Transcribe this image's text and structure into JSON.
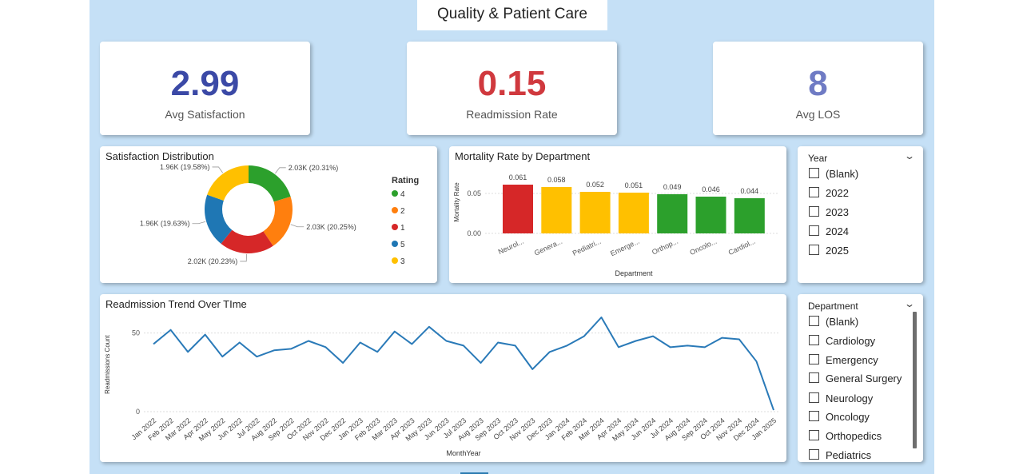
{
  "page_title": "Quality & Patient Care",
  "kpis": [
    {
      "value": "2.99",
      "label": "Avg Satisfaction",
      "color": "#3b49a6"
    },
    {
      "value": "0.15",
      "label": "Readmission Rate",
      "color": "#d0393e"
    },
    {
      "value": "8",
      "label": "Avg LOS",
      "color": "#6f7bc4"
    }
  ],
  "donut": {
    "title": "Satisfaction Distribution",
    "legend_title": "Rating",
    "chart_data": {
      "type": "pie",
      "slices": [
        {
          "rating": "4",
          "value": 2030,
          "label": "2.03K (20.31%)",
          "pct": 20.31,
          "color": "#2ca02c"
        },
        {
          "rating": "2",
          "value": 2030,
          "label": "2.03K (20.25%)",
          "pct": 20.25,
          "color": "#ff7f0e"
        },
        {
          "rating": "1",
          "value": 2020,
          "label": "2.02K (20.23%)",
          "pct": 20.23,
          "color": "#d62728"
        },
        {
          "rating": "5",
          "value": 1960,
          "label": "1.96K (19.63%)",
          "pct": 19.63,
          "color": "#1f77b4"
        },
        {
          "rating": "3",
          "value": 1960,
          "label": "1.96K (19.58%)",
          "pct": 19.58,
          "color": "#ffc000"
        }
      ]
    }
  },
  "mortality": {
    "title": "Mortality Rate by Department",
    "chart_data": {
      "type": "bar",
      "categories": [
        "Neurol...",
        "Genera...",
        "Pediatri...",
        "Emerge...",
        "Orthop...",
        "Oncolo...",
        "Cardiol..."
      ],
      "values": [
        0.061,
        0.058,
        0.052,
        0.051,
        0.049,
        0.046,
        0.044
      ],
      "data_labels": [
        "0.061",
        "0.058",
        "0.052",
        "0.051",
        "0.049",
        "0.046",
        "0.044"
      ],
      "colors": [
        "#d62728",
        "#ffc000",
        "#ffc000",
        "#ffc000",
        "#2ca02c",
        "#2ca02c",
        "#2ca02c"
      ],
      "xlabel": "Department",
      "ylabel": "Mortality Rate",
      "yticks": [
        "0.00",
        "0.05"
      ],
      "ylim": [
        0,
        0.07
      ]
    }
  },
  "trend": {
    "title": "Readmission Trend Over TIme",
    "chart_data": {
      "type": "line",
      "x": [
        "Jan 2022",
        "Feb 2022",
        "Mar 2022",
        "Apr 2022",
        "May 2022",
        "Jun 2022",
        "Jul 2022",
        "Aug 2022",
        "Sep 2022",
        "Oct 2022",
        "Nov 2022",
        "Dec 2022",
        "Jan 2023",
        "Feb 2023",
        "Mar 2023",
        "Apr 2023",
        "May 2023",
        "Jun 2023",
        "Jul 2023",
        "Aug 2023",
        "Sep 2023",
        "Oct 2023",
        "Nov 2023",
        "Dec 2023",
        "Jan 2024",
        "Feb 2024",
        "Mar 2024",
        "Apr 2024",
        "May 2024",
        "Jun 2024",
        "Jul 2024",
        "Aug 2024",
        "Sep 2024",
        "Oct 2024",
        "Nov 2024",
        "Dec 2024",
        "Jan 2025"
      ],
      "series": [
        {
          "values": [
            43,
            52,
            38,
            49,
            35,
            44,
            35,
            39,
            40,
            45,
            41,
            31,
            44,
            38,
            51,
            43,
            54,
            45,
            42,
            31,
            44,
            42,
            27,
            38,
            42,
            48,
            60,
            41,
            45,
            48,
            41,
            42,
            41,
            47,
            46,
            32,
            1
          ],
          "color": "#2a7ab8"
        }
      ],
      "xlabel": "MonthYear",
      "ylabel": "Readmissions Count",
      "yticks": [
        "0",
        "50"
      ],
      "ylim": [
        0,
        60
      ]
    }
  },
  "year_slicer": {
    "header": "Year",
    "items": [
      "(Blank)",
      "2022",
      "2023",
      "2024",
      "2025"
    ]
  },
  "dept_slicer": {
    "header": "Department",
    "items": [
      "(Blank)",
      "Cardiology",
      "Emergency",
      "General Surgery",
      "Neurology",
      "Oncology",
      "Orthopedics",
      "Pediatrics"
    ]
  }
}
